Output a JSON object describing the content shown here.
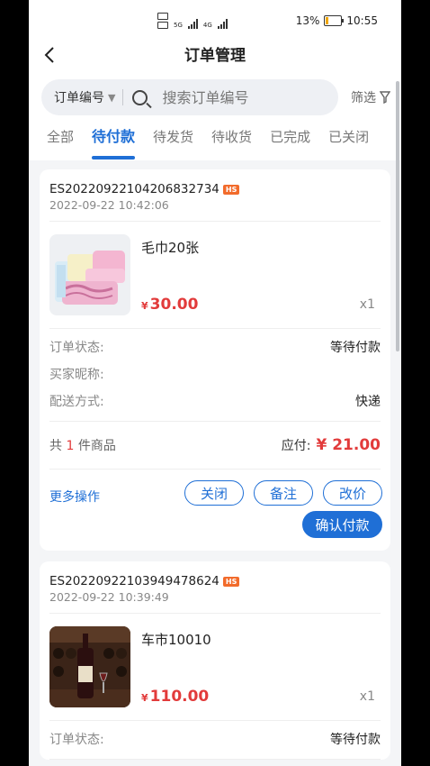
{
  "status": {
    "battery_percent": "13%",
    "time": "10:55",
    "signal_a": "5G",
    "signal_b": "4G"
  },
  "header": {
    "title": "订单管理"
  },
  "search": {
    "type_label": "订单编号",
    "placeholder": "搜索订单编号",
    "filter_label": "筛选"
  },
  "tabs": [
    {
      "label": "全部"
    },
    {
      "label": "待付款",
      "active": true
    },
    {
      "label": "待发货"
    },
    {
      "label": "待收货"
    },
    {
      "label": "已完成"
    },
    {
      "label": "已关闭"
    }
  ],
  "orders": [
    {
      "order_no": "ES20220922104206832734",
      "badge": "HS",
      "time": "2022-09-22 10:42:06",
      "product_name": "毛巾20张",
      "currency": "¥",
      "price": "30.00",
      "qty": "x1",
      "status_label": "订单状态:",
      "status_value": "等待付款",
      "buyer_label": "买家昵称:",
      "buyer_value": "",
      "delivery_label": "配送方式:",
      "delivery_value": "快递",
      "count_prefix": "共",
      "count": "1",
      "count_suffix": "件商品",
      "pay_label": "应付:",
      "pay_amount": "¥ 21.00",
      "more_label": "更多操作",
      "close_label": "关闭",
      "note_label": "备注",
      "reprice_label": "改价",
      "confirm_label": "确认付款"
    },
    {
      "order_no": "ES20220922103949478624",
      "badge": "HS",
      "time": "2022-09-22 10:39:49",
      "product_name": "车市10010",
      "currency": "¥",
      "price": "110.00",
      "qty": "x1",
      "status_label": "订单状态:",
      "status_value": "等待付款"
    }
  ],
  "colors": {
    "accent": "#1f6fd6",
    "price": "#e23b3b",
    "badge": "#f26b2b"
  }
}
